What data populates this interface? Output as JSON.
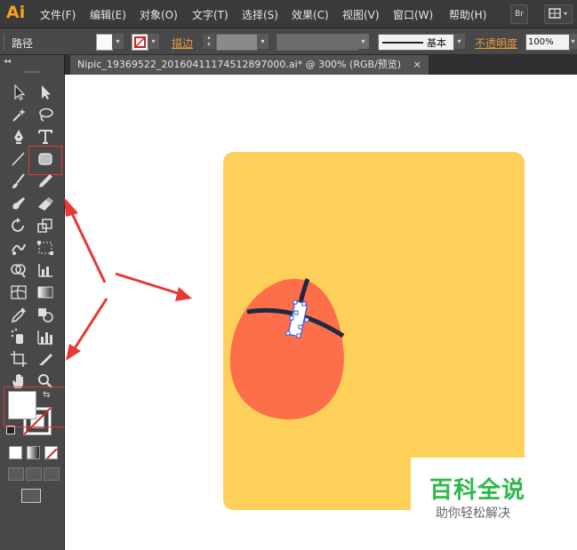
{
  "app": {
    "logo": "Ai"
  },
  "menu": {
    "items": [
      "文件(F)",
      "编辑(E)",
      "对象(O)",
      "文字(T)",
      "选择(S)",
      "效果(C)",
      "视图(V)",
      "窗口(W)",
      "帮助(H)"
    ],
    "bridge_label": "Br"
  },
  "control": {
    "selection_label": "路径",
    "stroke_label": "描边",
    "stroke_style": "基本",
    "opacity_label": "不透明度",
    "opacity_value": "100%"
  },
  "document": {
    "tab_title": "Nipic_19369522_20160411174512897000.ai*  @  300%  (RGB/预览)",
    "tab_close": "×"
  },
  "watermark": {
    "title": "百科全说",
    "subtitle": "助你轻松解决"
  },
  "colors": {
    "artboard_fill": "#fdd05a",
    "egg_fill": "#fd6e4a",
    "line": "#1e2a40",
    "annotation_red": "#e53935"
  },
  "icons": [
    "selection-tool-icon",
    "direct-selection-tool-icon",
    "magic-wand-icon",
    "lasso-icon",
    "pen-tool-icon",
    "type-tool-icon",
    "line-tool-icon",
    "rounded-rectangle-tool-icon",
    "paintbrush-icon",
    "pencil-icon",
    "blob-brush-icon",
    "eraser-icon",
    "rotate-icon",
    "scale-icon",
    "warp-icon",
    "free-transform-icon",
    "shape-builder-icon",
    "graph-icon",
    "mesh-icon",
    "gradient-icon",
    "eyedropper-icon",
    "blend-icon",
    "symbol-sprayer-icon",
    "column-graph-icon",
    "artboard-icon",
    "slice-icon",
    "hand-icon",
    "zoom-icon"
  ]
}
